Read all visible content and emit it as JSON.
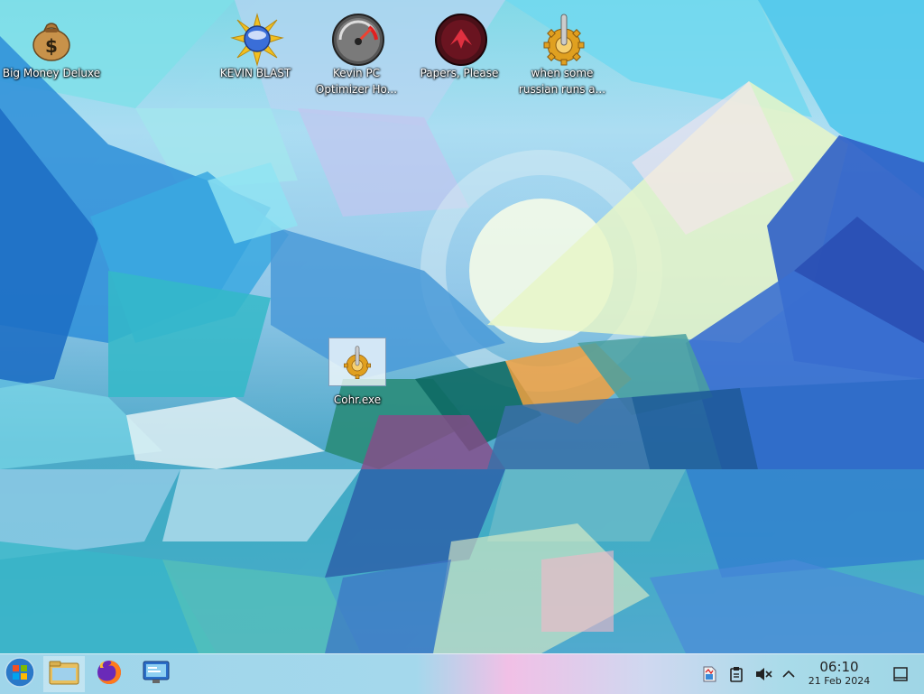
{
  "desktop_icons": [
    {
      "name": "big-money-deluxe",
      "label": "Big Money Deluxe",
      "icon": "money-bag-icon"
    },
    {
      "name": "kevin-blast",
      "label": "KEVIN BLAST",
      "icon": "starburst-orb-icon"
    },
    {
      "name": "kevin-pc-optimizer",
      "label": "Kevin PC Optimizer Ho...",
      "icon": "speedometer-icon"
    },
    {
      "name": "papers-please",
      "label": "Papers, Please",
      "icon": "papers-please-emblem-icon"
    },
    {
      "name": "when-some-russian",
      "label": "when some russian runs a...",
      "icon": "gear-icon"
    },
    {
      "name": "cohr-exe",
      "label": "Cohr.exe",
      "icon": "gear-icon"
    }
  ],
  "taskbar": {
    "start": "start-orb-icon",
    "pinned": [
      "file-manager-icon",
      "firefox-icon",
      "control-panel-icon"
    ],
    "tray": [
      "system-monitor-icon",
      "clipboard-icon",
      "volume-muted-icon",
      "chevron-up-icon"
    ],
    "time": "06:10",
    "date": "21 Feb 2024",
    "show_desktop": "show-desktop-icon"
  }
}
